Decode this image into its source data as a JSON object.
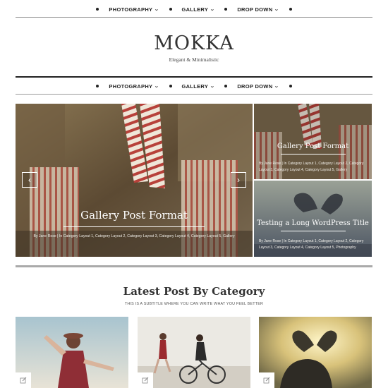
{
  "top_nav": {
    "items": [
      {
        "label": "PHOTOGRAPHY"
      },
      {
        "label": "GALLERY"
      },
      {
        "label": "DROP DOWN"
      }
    ]
  },
  "header": {
    "logo": "MOKKA",
    "tagline": "Elegant & Minimalistic"
  },
  "main_nav": {
    "items": [
      {
        "label": "PHOTOGRAPHY"
      },
      {
        "label": "GALLERY"
      },
      {
        "label": "DROP DOWN"
      }
    ]
  },
  "slider": {
    "title": "Gallery Post Format",
    "meta": "By Jane Rose | In Category Layout 1, Category Layout 2, Category Layout 3, Category Layout 4, Category Layout 5, Gallery",
    "prev_arrow": "‹",
    "next_arrow": "›"
  },
  "side_posts": [
    {
      "title": "Gallery Post Format",
      "meta": "By Jane Rose | In Category Layout 1, Category Layout 2, Category Layout 3, Category Layout 4, Category Layout 5, Gallery"
    },
    {
      "title": "Testing a Long WordPress Title",
      "meta": "By Jane Rose | In Category Layout 1, Category Layout 2, Category Layout 3, Category Layout 4, Category Layout 5, Photography"
    }
  ],
  "section": {
    "title": "Latest Post By Category",
    "subtitle": "THIS IS A SUBTITLE WHERE YOU CAN WRITE WHAT YOU FEEL BETTER"
  },
  "icons": {
    "chevron": "chevron-down-icon",
    "edit": "edit-icon"
  }
}
